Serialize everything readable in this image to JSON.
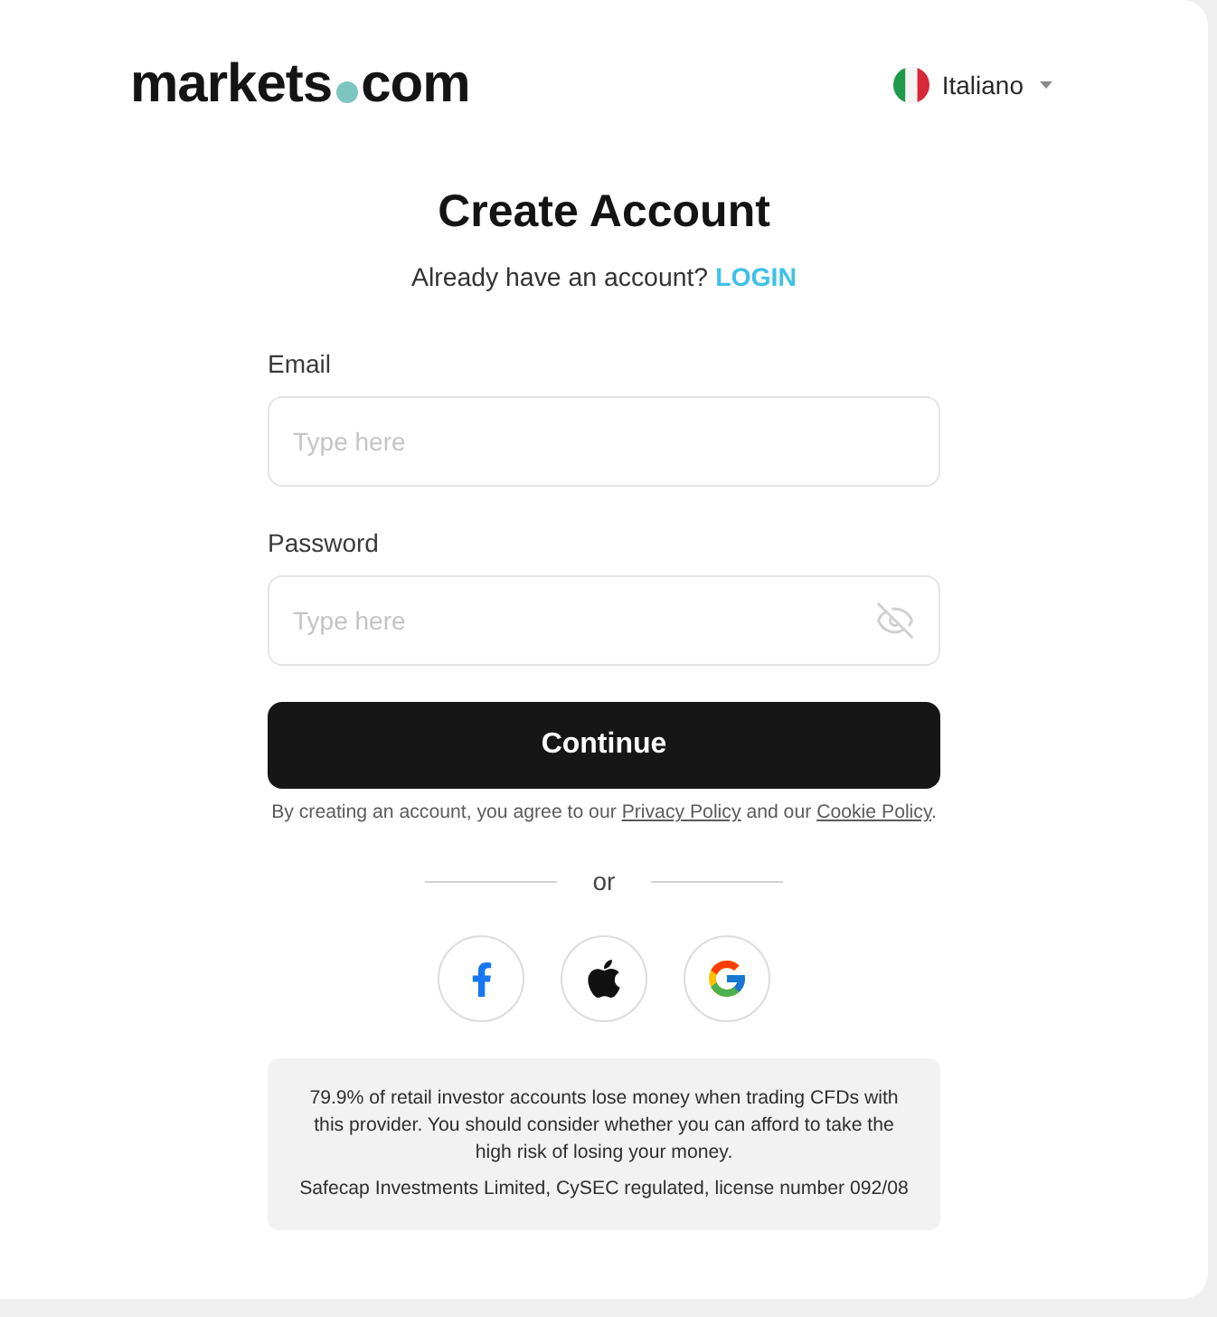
{
  "header": {
    "logo": {
      "name": "markets",
      "suffix": "com"
    },
    "language": {
      "label": "Italiano"
    }
  },
  "heading": {
    "title": "Create Account",
    "prompt": "Already have an account?",
    "link": "LOGIN"
  },
  "fields": [
    {
      "kind": "text",
      "label": "Email",
      "placeholder": "Type here"
    },
    {
      "kind": "password",
      "label": "Password",
      "placeholder": "Type here"
    }
  ],
  "submit": {
    "label": "Continue"
  },
  "terms": [
    {
      "kind": "text",
      "text": "By creating an account, you agree to our "
    },
    {
      "kind": "link",
      "text": "Privacy Policy"
    },
    {
      "kind": "text",
      "text": " and our "
    },
    {
      "kind": "link",
      "text": "Cookie Policy"
    },
    {
      "kind": "text",
      "text": "."
    }
  ],
  "divider": {
    "label": "or"
  },
  "social": [
    {
      "kind": "facebook"
    },
    {
      "kind": "apple"
    },
    {
      "kind": "google"
    }
  ],
  "disclaimer": {
    "warning": "79.9% of retail investor accounts lose money when trading CFDs with this provider. You should consider whether you can afford to take the high risk of losing your money.",
    "license": "Safecap Investments Limited, CySEC regulated, license number 092/08"
  }
}
